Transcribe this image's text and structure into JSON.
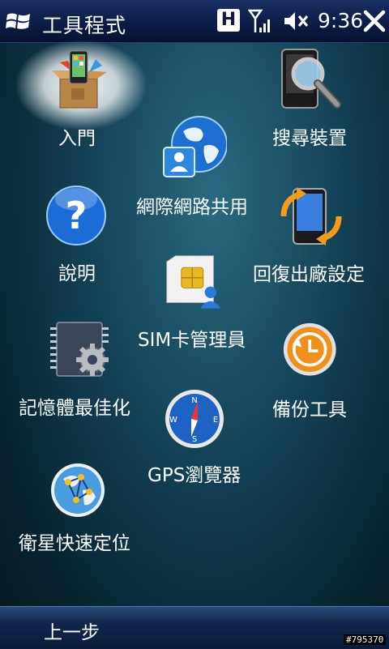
{
  "title_bar": {
    "title": "工具程式",
    "network_badge": "H",
    "time": "9:36"
  },
  "apps": [
    {
      "id": "getting-started",
      "label": "入門"
    },
    {
      "id": "internet-sharing",
      "label": "網際網路共用"
    },
    {
      "id": "search-device",
      "label": "搜尋裝置"
    },
    {
      "id": "help",
      "label": "說明"
    },
    {
      "id": "factory-reset",
      "label": "回復出廠設定"
    },
    {
      "id": "sim-manager",
      "label": "SIM卡管理員"
    },
    {
      "id": "memory-optimizer",
      "label": "記憶體最佳化"
    },
    {
      "id": "backup",
      "label": "備份工具"
    },
    {
      "id": "gps-browser",
      "label": "GPS瀏覽器"
    },
    {
      "id": "quick-gps",
      "label": "衛星快速定位"
    }
  ],
  "bottom_bar": {
    "left_softkey": "上一步"
  },
  "watermark": "#795370",
  "colors": {
    "title_bar": "#0c1a44",
    "background": "#123f52",
    "accent_orange": "#f08a1c",
    "accent_blue": "#2a7bd8"
  }
}
